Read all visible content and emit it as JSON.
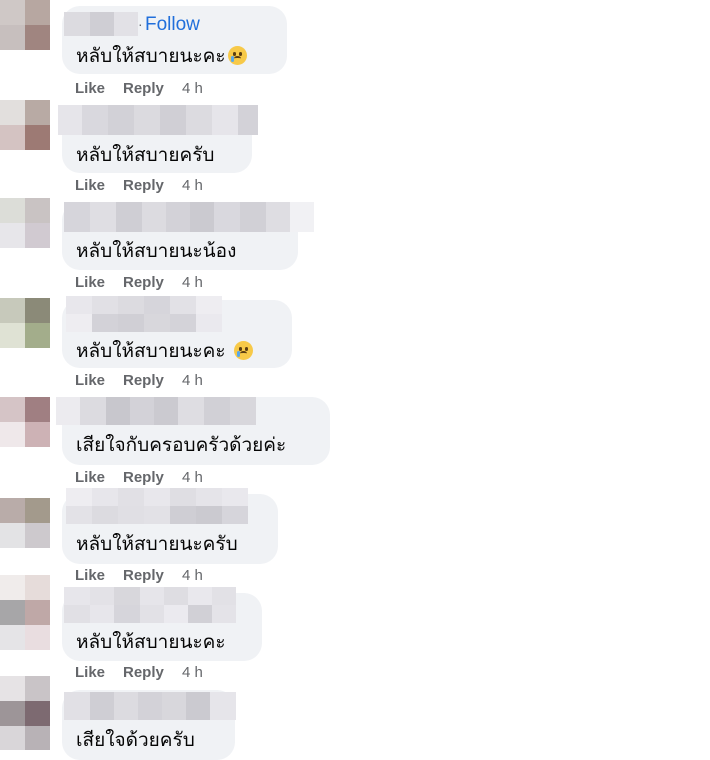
{
  "follow_label": "Follow",
  "follow_dot": "·",
  "actions": {
    "like": "Like",
    "reply": "Reply"
  },
  "comments": [
    {
      "text": "หลับให้สบายนะคะ",
      "emoji": "crying-face-emoji",
      "time": "4 h"
    },
    {
      "text": "หลับให้สบายครับ",
      "time": "4 h"
    },
    {
      "text": "หลับให้สบายนะน้อง",
      "time": "4 h"
    },
    {
      "text": "หลับให้สบายนะคะ ",
      "emoji": "crying-face-emoji",
      "time": "4 h"
    },
    {
      "text": "เสียใจกับครอบครัวด้วยค่ะ",
      "time": "4 h"
    },
    {
      "text": "หลับให้สบายนะครับ",
      "time": "4 h"
    },
    {
      "text": "หลับให้สบายนะคะ",
      "time": "4 h"
    },
    {
      "text": "เสียใจด้วยครับ"
    }
  ],
  "colors": {
    "bubble": "#f0f2f5",
    "follow": "#216fdb",
    "meta": "#65676b",
    "text": "#050505"
  }
}
